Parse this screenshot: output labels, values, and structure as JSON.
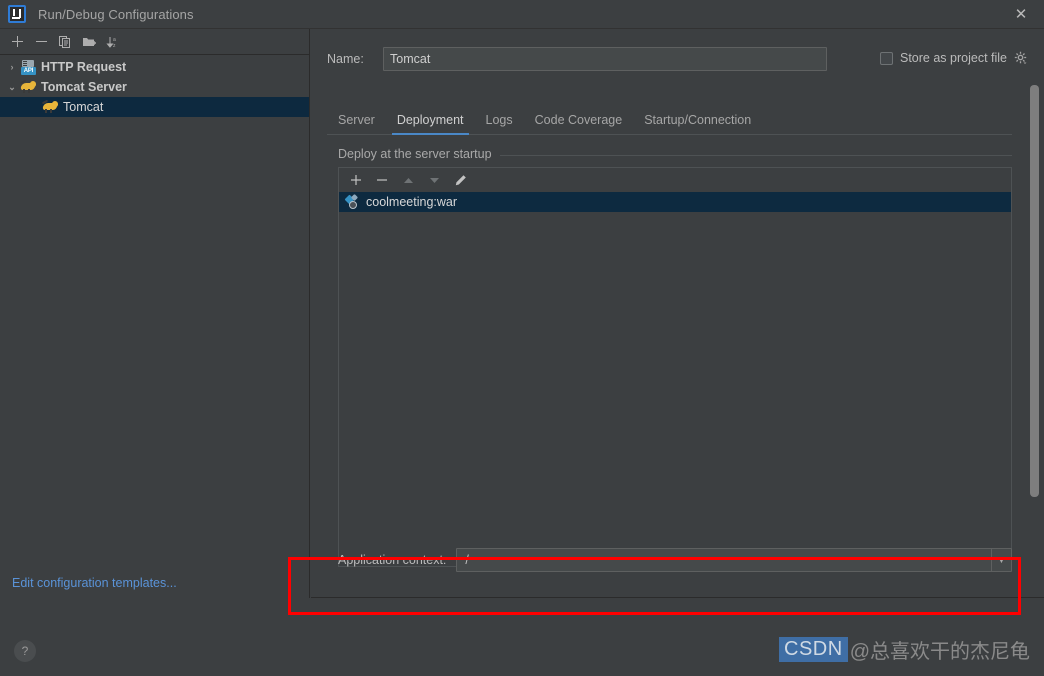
{
  "window": {
    "title": "Run/Debug Configurations",
    "logo_icon": "intellij-idea-icon",
    "close_icon": "close-icon"
  },
  "sidebar": {
    "toolbar": [
      {
        "name": "add-configuration-button",
        "icon": "plus-icon",
        "label": "+"
      },
      {
        "name": "remove-configuration-button",
        "icon": "minus-icon",
        "label": "−"
      },
      {
        "name": "copy-configuration-button",
        "icon": "copy-icon",
        "label": ""
      },
      {
        "name": "save-configuration-button",
        "icon": "folder-add-icon",
        "label": ""
      },
      {
        "name": "sort-configurations-button",
        "icon": "sort-az-icon",
        "label": ""
      }
    ],
    "tree": [
      {
        "label": "HTTP Request",
        "icon": "api-icon",
        "twisty": "›",
        "expanded": false,
        "level": 0,
        "bold": true,
        "selected": false
      },
      {
        "label": "Tomcat Server",
        "icon": "tomcat-icon",
        "twisty": "⌄",
        "expanded": true,
        "level": 0,
        "bold": true,
        "selected": false
      },
      {
        "label": "Tomcat",
        "icon": "tomcat-icon",
        "twisty": "",
        "expanded": false,
        "level": 1,
        "bold": false,
        "selected": true
      }
    ],
    "templates_link": "Edit configuration templates..."
  },
  "content": {
    "name_label": "Name:",
    "name_value": "Tomcat",
    "store_as_project_file": {
      "label": "Store as project file",
      "checked": false,
      "gear_icon": "gear-icon"
    },
    "tabs": [
      {
        "label": "Server",
        "active": false
      },
      {
        "label": "Deployment",
        "active": true
      },
      {
        "label": "Logs",
        "active": false
      },
      {
        "label": "Code Coverage",
        "active": false
      },
      {
        "label": "Startup/Connection",
        "active": false
      }
    ],
    "group_title": "Deploy at the server startup",
    "list_toolbar": [
      {
        "name": "add-artifact-button",
        "icon": "plus-icon",
        "glyph": "+",
        "enabled": true
      },
      {
        "name": "remove-artifact-button",
        "icon": "minus-icon",
        "glyph": "−",
        "enabled": true
      },
      {
        "name": "move-up-button",
        "icon": "arrow-up-icon",
        "glyph": "▲",
        "enabled": false
      },
      {
        "name": "move-down-button",
        "icon": "arrow-down-icon",
        "glyph": "▼",
        "enabled": false
      },
      {
        "name": "edit-artifact-button",
        "icon": "pencil-icon",
        "glyph": "✎",
        "enabled": true
      }
    ],
    "deploy_items": [
      {
        "label": "coolmeeting:war",
        "icon": "artifact-icon",
        "selected": true
      }
    ],
    "application_context": {
      "label": "Application context:",
      "value": "/",
      "arrow_icon": "chevron-down-icon"
    }
  },
  "footer": {
    "help_label": "?",
    "help_icon": "help-icon"
  },
  "annotation": {
    "color": "#ff0000",
    "shape": "rectangle"
  },
  "watermark": {
    "brand": "CSDN",
    "handle": "@总喜欢干的杰尼龟"
  }
}
